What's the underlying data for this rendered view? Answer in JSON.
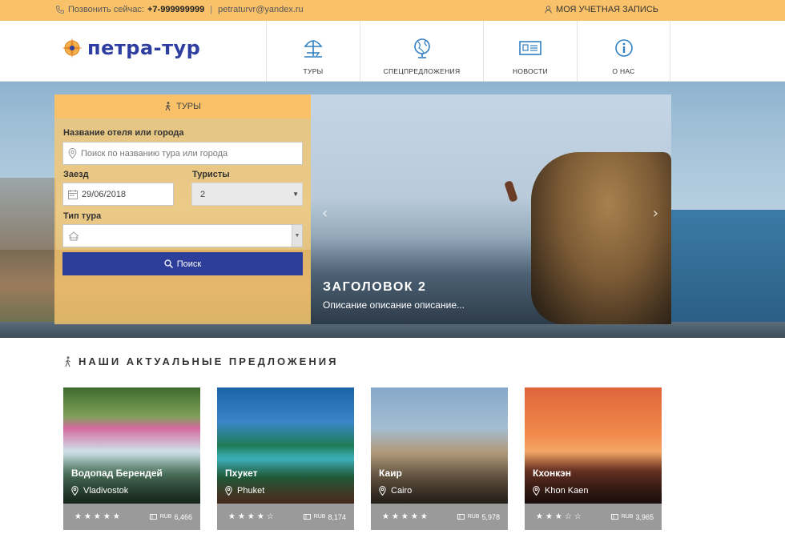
{
  "topbar": {
    "call_label": "Позвонить сейчас:",
    "phone": "+7-999999999",
    "separator": "|",
    "email": "petraturvr@yandex.ru",
    "account_label": "МОЯ УЧЕТНАЯ ЗАПИСЬ"
  },
  "header": {
    "logo_text": "петра-тур",
    "nav": [
      {
        "label": "ТУРЫ",
        "icon": "beach-umbrella-icon"
      },
      {
        "label": "СПЕЦПРЕДЛОЖЕНИЯ",
        "icon": "globe-icon"
      },
      {
        "label": "НОВОСТИ",
        "icon": "news-card-icon"
      },
      {
        "label": "О НАС",
        "icon": "info-icon"
      }
    ]
  },
  "search": {
    "tab_label": "ТУРЫ",
    "hotel_label": "Название отеля или города",
    "hotel_placeholder": "Поиск по названию тура или города",
    "checkin_label": "Заезд",
    "checkin_value": "29/06/2018",
    "tourists_label": "Туристы",
    "tourists_value": "2",
    "tour_type_label": "Тип тура",
    "tour_type_value": "",
    "search_button": "Поиск"
  },
  "slider": {
    "title": "ЗАГОЛОВОК 2",
    "text": "Описание описание описание...",
    "prev": "‹",
    "next": "›"
  },
  "offers": {
    "title": "НАШИ АКТУАЛЬНЫЕ ПРЕДЛОЖЕНИЯ",
    "currency": "RUB",
    "cards": [
      {
        "title": "Водопад Берендей",
        "city": "Vladivostok",
        "stars": 5,
        "stars_text": "★★★★★",
        "price": "6,466"
      },
      {
        "title": "Пхукет",
        "city": "Phuket",
        "stars": 4,
        "stars_text": "★★★★☆",
        "price": "8,174"
      },
      {
        "title": "Каир",
        "city": "Cairo",
        "stars": 5,
        "stars_text": "★★★★★",
        "price": "5,978"
      },
      {
        "title": "Кхонкэн",
        "city": "Khon Kaen",
        "stars": 3,
        "stars_text": "★★★☆☆",
        "price": "3,965"
      }
    ]
  },
  "colors": {
    "accent_yellow": "#f9c26a",
    "brand_blue": "#2c3e99",
    "logo_blue": "#2d3ea0"
  }
}
